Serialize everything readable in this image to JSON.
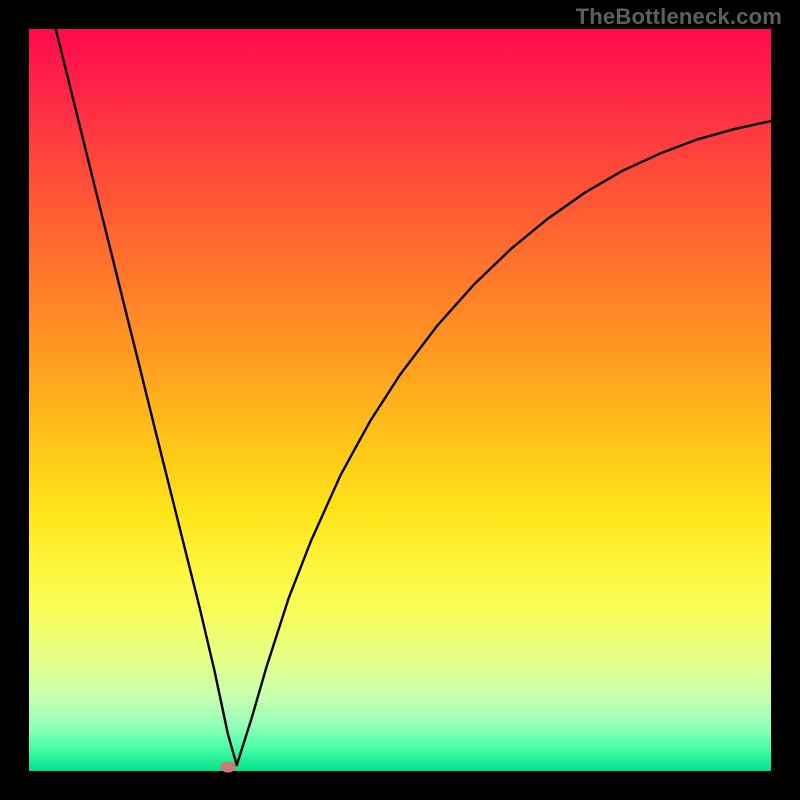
{
  "watermark": "TheBottleneck.com",
  "colors": {
    "frame": "#000000",
    "curve": "#000000",
    "marker": "#c97a75"
  },
  "chart_data": {
    "type": "line",
    "title": "",
    "xlabel": "",
    "ylabel": "",
    "xlim": [
      0,
      100
    ],
    "ylim": [
      0,
      100
    ],
    "grid": false,
    "legend": false,
    "note": "Values estimated from pixel positions; no axis ticks or numeric labels are rendered in the source image.",
    "series": [
      {
        "name": "bottleneck-curve",
        "x": [
          3.6,
          5,
          7,
          9,
          11,
          13,
          15,
          17,
          19,
          21,
          23,
          25,
          26.8,
          28,
          30,
          32,
          35,
          38,
          42,
          46,
          50,
          55,
          60,
          65,
          70,
          75,
          80,
          85,
          90,
          95,
          100
        ],
        "y": [
          100,
          94.4,
          86.3,
          78.2,
          70.2,
          62.1,
          54.1,
          46,
          38,
          30,
          22,
          13.5,
          5,
          0.8,
          7.1,
          14,
          23.3,
          31,
          39.9,
          47.2,
          53.4,
          60,
          65.6,
          70.4,
          74.5,
          78,
          80.9,
          83.2,
          85.1,
          86.5,
          87.6
        ]
      }
    ],
    "marker": {
      "x": 26.8,
      "y": 0.6
    },
    "gradient_background": {
      "direction": "vertical",
      "stops": [
        {
          "pos": 0.0,
          "color": "#ff0a4e"
        },
        {
          "pos": 0.1,
          "color": "#ff2b45"
        },
        {
          "pos": 0.22,
          "color": "#ff5436"
        },
        {
          "pos": 0.34,
          "color": "#ff7a2a"
        },
        {
          "pos": 0.46,
          "color": "#ffa21f"
        },
        {
          "pos": 0.57,
          "color": "#ffc918"
        },
        {
          "pos": 0.65,
          "color": "#ffe41a"
        },
        {
          "pos": 0.72,
          "color": "#fff43a"
        },
        {
          "pos": 0.79,
          "color": "#f8ff5e"
        },
        {
          "pos": 0.85,
          "color": "#e6ff88"
        },
        {
          "pos": 0.9,
          "color": "#c7ffad"
        },
        {
          "pos": 0.94,
          "color": "#92ffb8"
        },
        {
          "pos": 0.97,
          "color": "#45ffa6"
        },
        {
          "pos": 1.0,
          "color": "#00e18c"
        }
      ]
    }
  }
}
